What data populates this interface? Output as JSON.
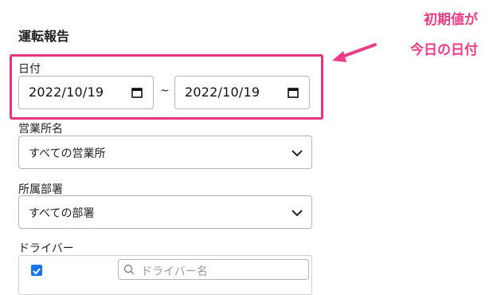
{
  "page": {
    "title": "運転報告"
  },
  "date_section": {
    "label": "日付",
    "start_value": "2022/10/19",
    "end_value": "2022/10/19",
    "separator": "~"
  },
  "office": {
    "label": "営業所名",
    "selected": "すべての営業所"
  },
  "department": {
    "label": "所属部署",
    "selected": "すべての部署"
  },
  "driver": {
    "label": "ドライバー",
    "all_checked": true,
    "search_placeholder": "ドライバー名"
  },
  "annotation": {
    "line1": "初期値が",
    "line2": "今日の日付",
    "color": "#ec3d86"
  },
  "colors": {
    "highlight": "#e8347a",
    "checkbox": "#1a73e8"
  }
}
